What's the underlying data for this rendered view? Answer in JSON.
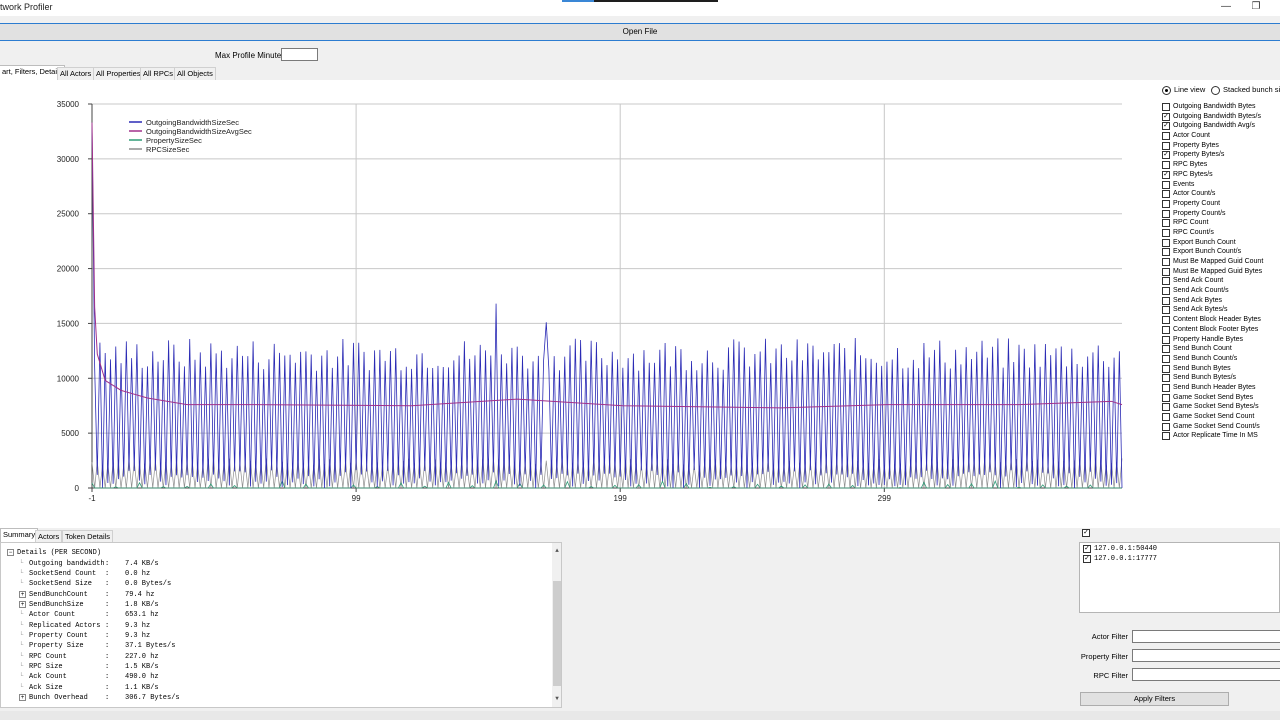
{
  "window": {
    "title": "twork Profiler",
    "minimize_glyph": "—",
    "restore_glyph": "❐"
  },
  "open_file_label": "Open File",
  "max_profile_label": "Max Profile Minutes:",
  "max_profile_value": "",
  "top_tabs": [
    "art, Filters, Details",
    "All Actors",
    "All Properties",
    "All RPCs",
    "All Objects"
  ],
  "view_options": {
    "line_view": "Line view",
    "stacked": "Stacked bunch siz",
    "selected": "line_view"
  },
  "metrics": [
    {
      "label": "Outgoing Bandwidth Bytes",
      "checked": false
    },
    {
      "label": "Outgoing Bandwidth Bytes/s",
      "checked": true
    },
    {
      "label": "Outgoing Bandwidth Avg/s",
      "checked": true
    },
    {
      "label": "Actor Count",
      "checked": false
    },
    {
      "label": "Property Bytes",
      "checked": false
    },
    {
      "label": "Property Bytes/s",
      "checked": true
    },
    {
      "label": "RPC Bytes",
      "checked": false
    },
    {
      "label": "RPC Bytes/s",
      "checked": true
    },
    {
      "label": "Events",
      "checked": false
    },
    {
      "label": "Actor Count/s",
      "checked": false
    },
    {
      "label": "Property Count",
      "checked": false
    },
    {
      "label": "Property Count/s",
      "checked": false
    },
    {
      "label": "RPC Count",
      "checked": false
    },
    {
      "label": "RPC Count/s",
      "checked": false
    },
    {
      "label": "Export Bunch Count",
      "checked": false
    },
    {
      "label": "Export Bunch Count/s",
      "checked": false
    },
    {
      "label": "Must Be Mapped Guid Count",
      "checked": false
    },
    {
      "label": "Must Be Mapped Guid Bytes",
      "checked": false
    },
    {
      "label": "Send Ack Count",
      "checked": false
    },
    {
      "label": "Send Ack Count/s",
      "checked": false
    },
    {
      "label": "Send Ack Bytes",
      "checked": false
    },
    {
      "label": "Send Ack Bytes/s",
      "checked": false
    },
    {
      "label": "Content Block Header Bytes",
      "checked": false
    },
    {
      "label": "Content Block Footer Bytes",
      "checked": false
    },
    {
      "label": "Property Handle Bytes",
      "checked": false
    },
    {
      "label": "Send Bunch Count",
      "checked": false
    },
    {
      "label": "Send Bunch Count/s",
      "checked": false
    },
    {
      "label": "Send Bunch Bytes",
      "checked": false
    },
    {
      "label": "Send Bunch Bytes/s",
      "checked": false
    },
    {
      "label": "Send Bunch Header Bytes",
      "checked": false
    },
    {
      "label": "Game Socket Send Bytes",
      "checked": false
    },
    {
      "label": "Game Socket Send Bytes/s",
      "checked": false
    },
    {
      "label": "Game Socket Send Count",
      "checked": false
    },
    {
      "label": "Game Socket Send Count/s",
      "checked": false
    },
    {
      "label": "Actor Replicate Time In MS",
      "checked": false
    }
  ],
  "chart_data": {
    "type": "line",
    "title": "",
    "xlabel": "",
    "ylabel": "",
    "xlim": [
      -1,
      389
    ],
    "ylim": [
      0,
      35000
    ],
    "y_ticks": [
      0,
      5000,
      10000,
      15000,
      20000,
      25000,
      30000,
      35000
    ],
    "x_ticks": [
      -1,
      99,
      199,
      299
    ],
    "grid": true,
    "legend_position": "top-left",
    "series": [
      {
        "name": "OutgoingBandwidthSizeSec",
        "color": "#2b2bb5",
        "pattern": "oscillating",
        "peak_approx": 33300,
        "typical_range": [
          0,
          13700
        ],
        "spikes": [
          {
            "x": 152,
            "y": 16800
          },
          {
            "x": 171,
            "y": 15100
          }
        ]
      },
      {
        "name": "OutgoingBandwidthSizeAvgSec",
        "color": "#a0308a",
        "points": [
          [
            -1,
            33300
          ],
          [
            0,
            16500
          ],
          [
            1,
            12200
          ],
          [
            4,
            9800
          ],
          [
            10,
            8900
          ],
          [
            20,
            8200
          ],
          [
            35,
            7600
          ],
          [
            60,
            7600
          ],
          [
            120,
            7500
          ],
          [
            160,
            8100
          ],
          [
            200,
            7500
          ],
          [
            260,
            7300
          ],
          [
            300,
            7600
          ],
          [
            350,
            7600
          ],
          [
            385,
            7900
          ],
          [
            389,
            7600
          ]
        ]
      },
      {
        "name": "PropertySizeSec",
        "color": "#2f9c77",
        "typical_range": [
          0,
          700
        ]
      },
      {
        "name": "RPCSizeSec",
        "color": "#8e8e8e",
        "typical_range": [
          0,
          2700
        ]
      }
    ]
  },
  "bottom_tabs": [
    "Summary",
    "Actors",
    "Token Details"
  ],
  "details": {
    "header": "Details (PER SECOND)",
    "rows": [
      {
        "label": "Outgoing bandwidth",
        "value": "7.4 KB/s",
        "expand": false
      },
      {
        "label": "SocketSend Count",
        "value": "0.0 hz",
        "expand": false
      },
      {
        "label": "SocketSend Size",
        "value": "0.0 Bytes/s",
        "expand": false
      },
      {
        "label": "SendBunchCount",
        "value": "79.4 hz",
        "expand": true
      },
      {
        "label": "SendBunchSize",
        "value": "1.8 KB/s",
        "expand": true
      },
      {
        "label": "Actor Count",
        "value": "653.1 hz",
        "expand": false
      },
      {
        "label": "Replicated Actors",
        "value": "9.3 hz",
        "expand": false
      },
      {
        "label": "Property Count",
        "value": "9.3 hz",
        "expand": false
      },
      {
        "label": "Property Size",
        "value": "37.1 Bytes/s",
        "expand": false
      },
      {
        "label": "RPC Count",
        "value": "227.0 hz",
        "expand": false
      },
      {
        "label": "RPC Size",
        "value": "1.5 KB/s",
        "expand": false
      },
      {
        "label": "Ack Count",
        "value": "490.0 hz",
        "expand": false
      },
      {
        "label": "Ack Size",
        "value": "1.1 KB/s",
        "expand": false
      },
      {
        "label": "Bunch Overhead",
        "value": "306.7 Bytes/s",
        "expand": true
      }
    ]
  },
  "connections": [
    {
      "label": "127.0.0.1:50440",
      "checked": true
    },
    {
      "label": "127.0.0.1:17777",
      "checked": true
    }
  ],
  "filters": {
    "actor": "Actor Filter",
    "property": "Property Filter",
    "rpc": "RPC Filter",
    "apply": "Apply Filters"
  }
}
